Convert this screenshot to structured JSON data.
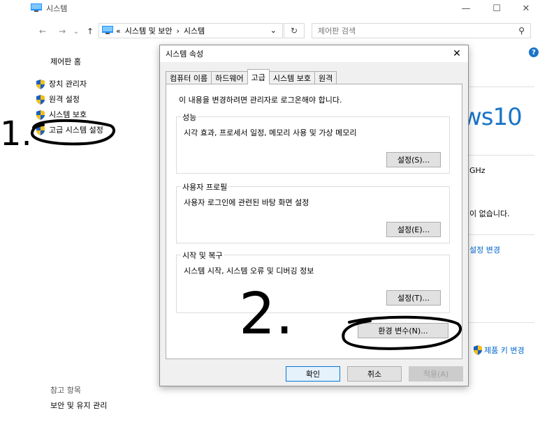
{
  "window": {
    "title": "시스템",
    "minimize": "—",
    "maximize": "☐",
    "close": "✕"
  },
  "address_bar": {
    "back": "←",
    "forward": "→",
    "dropdown": "⌄",
    "up": "↑",
    "chevrons": "«",
    "crumb_1": "시스템 및 보안",
    "separator": "›",
    "crumb_2": "시스템",
    "crumb_dropdown": "⌄",
    "refresh": "↻",
    "search_placeholder": "제어판 검색",
    "search_icon": "⚲"
  },
  "left_pane": {
    "home": "제어판 홈",
    "items": [
      "장치 관리자",
      "원격 설정",
      "시스템 보호",
      "고급 시스템 설정"
    ],
    "see_also": "참고 항목",
    "see_also_item": "보안 및 유지 관리"
  },
  "right_pane": {
    "help": "?",
    "win_logo_fragment": "ws10",
    "ghz_fragment": "GHz",
    "no_input_fragment": "이 없습니다.",
    "settings_change_fragment": "설정 변경",
    "product_key_change": "제품 키 변경"
  },
  "dialog": {
    "title": "시스템 속성",
    "close": "✕",
    "tabs": [
      {
        "label": "컴퓨터 이름",
        "active": false
      },
      {
        "label": "하드웨어",
        "active": false
      },
      {
        "label": "고급",
        "active": true
      },
      {
        "label": "시스템 보호",
        "active": false
      },
      {
        "label": "원격",
        "active": false
      }
    ],
    "admin_note": "이 내용을 변경하려면 관리자로 로그온해야 합니다.",
    "performance": {
      "label": "성능",
      "desc": "시각 효과, 프로세서 일정, 메모리 사용 및 가상 메모리",
      "button": "설정(S)..."
    },
    "user_profile": {
      "label": "사용자 프로필",
      "desc": "사용자 로그인에 관련된 바탕 화면 설정",
      "button": "설정(E)..."
    },
    "startup_recovery": {
      "label": "시작 및 복구",
      "desc": "시스템 시작, 시스템 오류 및 디버깅 정보",
      "button": "설정(T)..."
    },
    "env_vars_button": "환경 변수(N)...",
    "ok": "확인",
    "cancel": "취소",
    "apply": "적용(A)"
  },
  "annotations": {
    "step1": "1.",
    "step2": "2."
  },
  "colors": {
    "accent": "#0078d7",
    "link": "#0066cc",
    "win_logo": "#1a74c8",
    "dialog_bg": "#f0f0f0",
    "annotation_ink": "#000000"
  }
}
